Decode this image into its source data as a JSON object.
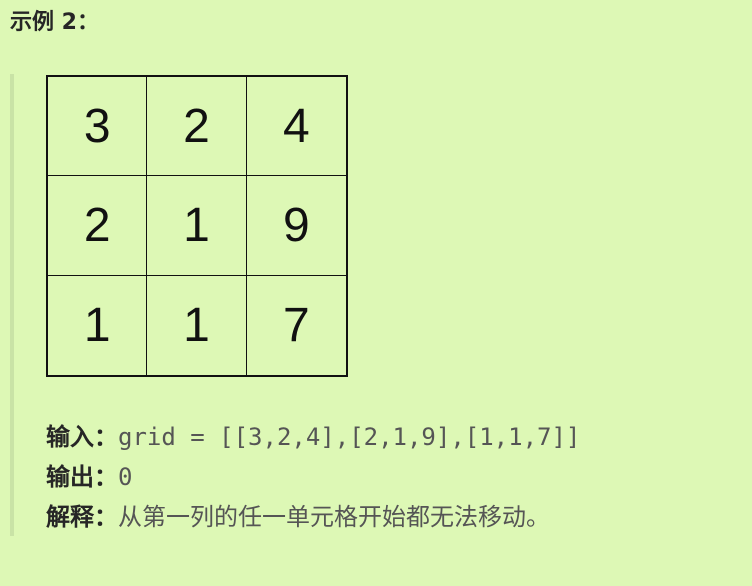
{
  "title": "示例 2：",
  "grid": [
    [
      "3",
      "2",
      "4"
    ],
    [
      "2",
      "1",
      "9"
    ],
    [
      "1",
      "1",
      "7"
    ]
  ],
  "input_label": "输入：",
  "input_value": "grid = [[3,2,4],[2,1,9],[1,1,7]]",
  "output_label": "输出：",
  "output_value": "0",
  "explain_label": "解释：",
  "explain_value": "从第一列的任一单元格开始都无法移动。"
}
